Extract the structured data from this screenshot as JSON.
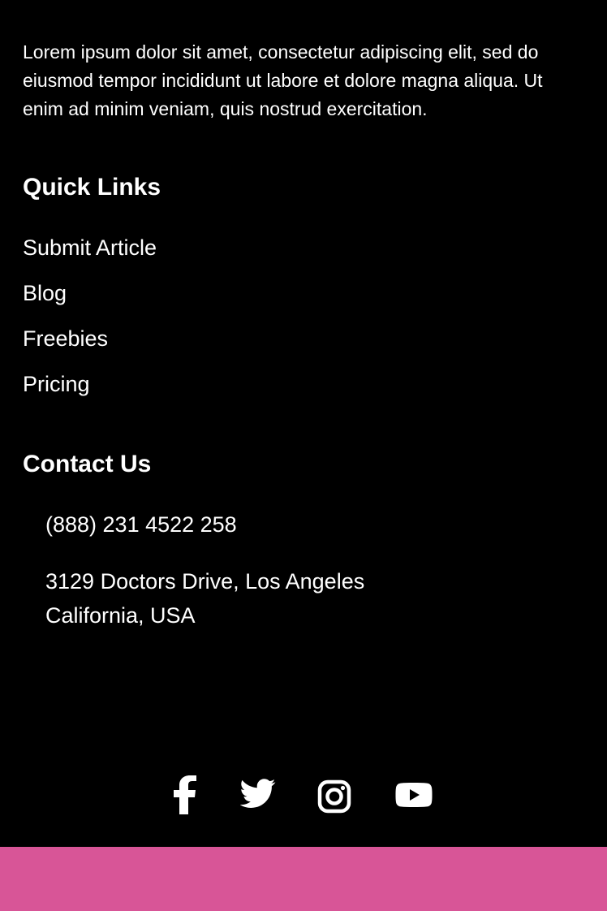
{
  "footer": {
    "description": "Lorem ipsum dolor sit amet, consectetur adipiscing elit, sed do eiusmod tempor incididunt ut labore et dolore magna aliqua. Ut enim ad minim veniam, quis nostrud exercitation.",
    "quick_links": {
      "title": "Quick Links",
      "items": [
        {
          "label": "Submit Article"
        },
        {
          "label": "Blog"
        },
        {
          "label": "Freebies"
        },
        {
          "label": "Pricing"
        }
      ]
    },
    "contact": {
      "title": "Contact Us",
      "phone": "(888) 231 4522 258",
      "address_line_1": "3129 Doctors Drive, Los Angeles",
      "address_line_2": "California, USA"
    },
    "social_icons": [
      "facebook-icon",
      "twitter-icon",
      "instagram-icon",
      "youtube-icon"
    ]
  },
  "colors": {
    "background": "#000000",
    "text": "#ffffff",
    "bottom_band": "#d85597"
  }
}
